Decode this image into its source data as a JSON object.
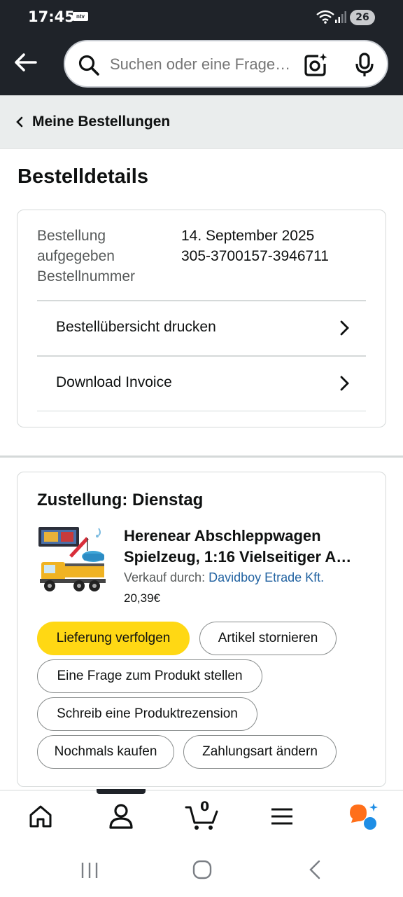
{
  "status_bar": {
    "time": "17:45",
    "app_badge": "ntv",
    "battery": "26"
  },
  "search": {
    "placeholder": "Suchen oder eine Frage stellen"
  },
  "breadcrumb": {
    "label": "Meine Bestellungen"
  },
  "page_title": "Bestelldetails",
  "order": {
    "placed_label": "Bestellung aufgegeben",
    "placed_label_line1": "Bestellung",
    "placed_label_line2": "aufgegeben",
    "number_label": "Bestellnummer",
    "placed_date": "14. September 2025",
    "order_number": "305-3700157-3946711",
    "links": [
      {
        "label": "Bestellübersicht drucken"
      },
      {
        "label": "Download Invoice"
      }
    ]
  },
  "delivery": {
    "title": "Zustellung: Dienstag",
    "product": {
      "title": "Herenear Abschleppwagen Spielzeug, 1:16 Vielseitiger A…",
      "title_line1": "Herenear Abschleppwagen",
      "title_line2": "Spielzeug, 1:16 Vielseitiger A…",
      "seller_prefix": "Verkauf durch:",
      "seller_name": "Davidboy Etrade Kft.",
      "price": "20,39€"
    },
    "actions": [
      {
        "label": "Lieferung verfolgen",
        "primary": true
      },
      {
        "label": "Artikel stornieren"
      },
      {
        "label": "Eine Frage zum Produkt stellen"
      },
      {
        "label": "Schreib eine Produktrezension"
      },
      {
        "label": "Nochmals kaufen"
      },
      {
        "label": "Zahlungsart ändern"
      }
    ]
  },
  "bottom_nav": {
    "items": [
      "home-icon",
      "account-icon",
      "cart-icon",
      "menu-icon",
      "rufus-ai-icon"
    ],
    "cart_count": "0",
    "active_item": "account-icon"
  },
  "colors": {
    "header_bg": "#1f2329",
    "primary_button": "#ffd814",
    "link": "#2162a1",
    "ai_orange": "#ff6f1a",
    "ai_blue": "#1f8ee5"
  }
}
